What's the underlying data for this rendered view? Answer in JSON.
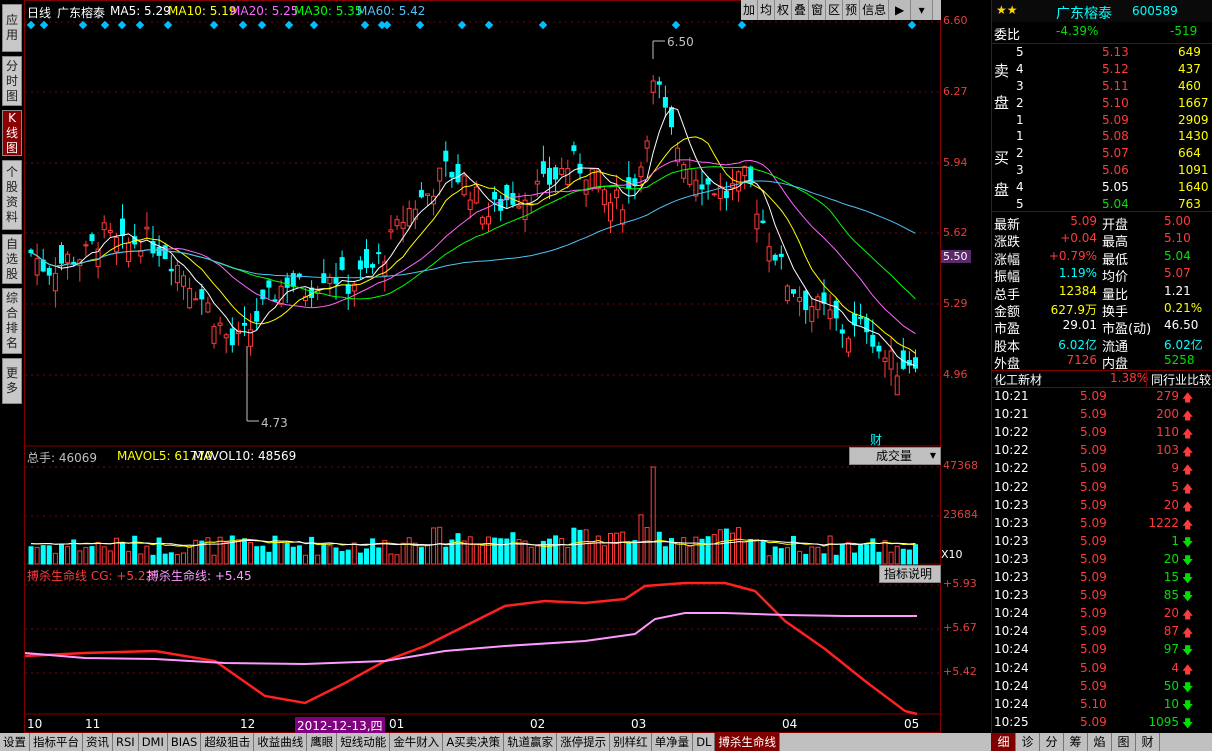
{
  "sidebar": {
    "tabs": [
      "应用",
      "分时图",
      "K线图",
      "个股资料",
      "自选股",
      "综合排名",
      "更多"
    ],
    "active": 2
  },
  "toolbar": {
    "items": [
      "加",
      "均",
      "权",
      "叠",
      "窗",
      "区",
      "预",
      "信息"
    ]
  },
  "kline": {
    "period_label": "日线",
    "stock_name": "广东榕泰",
    "ma5": "MA5: 5.29",
    "ma10": "MA10: 5.19",
    "ma20": "MA20: 5.25",
    "ma30": "MA30: 5.35",
    "ma60": "MA60: 5.42",
    "price_ticks": [
      "6.60",
      "6.27",
      "5.94",
      "5.62",
      "5.29",
      "4.96"
    ],
    "current_price_tag": "5.50",
    "high_label": "6.50",
    "low_label": "4.73",
    "cai_label": "财"
  },
  "volume": {
    "total_label": "总手: 46069",
    "mavol5": "MAVOL5: 61770",
    "mavol10": "MAVOL10: 48569",
    "selector": "成交量",
    "ticks": [
      "47368",
      "23684"
    ],
    "multiplier": "X10"
  },
  "indicator": {
    "name": "搏杀生命线 CG: +5.22",
    "name2": "搏杀生命线: +5.45",
    "help": "指标说明",
    "ticks": [
      "+5.93",
      "+5.67",
      "+5.42"
    ]
  },
  "xaxis": {
    "labels": [
      "10",
      "11",
      "12",
      "01",
      "02",
      "03",
      "04",
      "05"
    ],
    "cursor_date": "2012-12-13,四"
  },
  "quote": {
    "name": "广东榕泰",
    "code": "600589",
    "weibi_label": "委比",
    "weibi": "-4.39%",
    "weicha": "-519",
    "sell_label": [
      "卖",
      "盘"
    ],
    "buy_label": [
      "买",
      "盘"
    ],
    "sell": [
      {
        "n": "5",
        "p": "5.13",
        "v": "649"
      },
      {
        "n": "4",
        "p": "5.12",
        "v": "437"
      },
      {
        "n": "3",
        "p": "5.11",
        "v": "460"
      },
      {
        "n": "2",
        "p": "5.10",
        "v": "1667"
      },
      {
        "n": "1",
        "p": "5.09",
        "v": "2909"
      }
    ],
    "buy": [
      {
        "n": "1",
        "p": "5.08",
        "v": "1430"
      },
      {
        "n": "2",
        "p": "5.07",
        "v": "664"
      },
      {
        "n": "3",
        "p": "5.06",
        "v": "1091"
      },
      {
        "n": "4",
        "p": "5.05",
        "v": "1640"
      },
      {
        "n": "5",
        "p": "5.04",
        "v": "763"
      }
    ],
    "stats": [
      {
        "l": "最新",
        "v": "5.09",
        "l2": "开盘",
        "v2": "5.00"
      },
      {
        "l": "涨跌",
        "v": "+0.04",
        "l2": "最高",
        "v2": "5.10"
      },
      {
        "l": "涨幅",
        "v": "+0.79%",
        "l2": "最低",
        "v2": "5.04"
      },
      {
        "l": "振幅",
        "v": "1.19%",
        "l2": "均价",
        "v2": "5.07"
      },
      {
        "l": "总手",
        "v": "12384",
        "l2": "量比",
        "v2": "1.21"
      },
      {
        "l": "金额",
        "v": "627.9万",
        "l2": "换手",
        "v2": "0.21%"
      },
      {
        "l": "市盈",
        "v": "29.01",
        "l2": "市盈(动)",
        "v2": "46.50"
      },
      {
        "l": "股本",
        "v": "6.02亿",
        "l2": "流通",
        "v2": "6.02亿"
      },
      {
        "l": "外盘",
        "v": "7126",
        "l2": "内盘",
        "v2": "5258"
      }
    ],
    "industry": "化工新材",
    "industry_pct": "1.38%",
    "industry_btn": "同行业比较",
    "ticks": [
      {
        "t": "10:21",
        "p": "5.09",
        "v": "279",
        "d": "up"
      },
      {
        "t": "10:21",
        "p": "5.09",
        "v": "200",
        "d": "up"
      },
      {
        "t": "10:22",
        "p": "5.09",
        "v": "110",
        "d": "up"
      },
      {
        "t": "10:22",
        "p": "5.09",
        "v": "103",
        "d": "up"
      },
      {
        "t": "10:22",
        "p": "5.09",
        "v": "9",
        "d": "up"
      },
      {
        "t": "10:22",
        "p": "5.09",
        "v": "5",
        "d": "up"
      },
      {
        "t": "10:23",
        "p": "5.09",
        "v": "20",
        "d": "up"
      },
      {
        "t": "10:23",
        "p": "5.09",
        "v": "1222",
        "d": "up"
      },
      {
        "t": "10:23",
        "p": "5.09",
        "v": "1",
        "d": "down"
      },
      {
        "t": "10:23",
        "p": "5.09",
        "v": "20",
        "d": "down"
      },
      {
        "t": "10:23",
        "p": "5.09",
        "v": "15",
        "d": "down"
      },
      {
        "t": "10:23",
        "p": "5.09",
        "v": "85",
        "d": "down"
      },
      {
        "t": "10:24",
        "p": "5.09",
        "v": "20",
        "d": "up"
      },
      {
        "t": "10:24",
        "p": "5.09",
        "v": "87",
        "d": "up"
      },
      {
        "t": "10:24",
        "p": "5.09",
        "v": "97",
        "d": "down"
      },
      {
        "t": "10:24",
        "p": "5.09",
        "v": "4",
        "d": "up"
      },
      {
        "t": "10:24",
        "p": "5.09",
        "v": "50",
        "d": "down"
      },
      {
        "t": "10:24",
        "p": "5.10",
        "v": "10",
        "d": "down"
      },
      {
        "t": "10:25",
        "p": "5.09",
        "v": "1095",
        "d": "down"
      }
    ],
    "bottom_tabs": [
      "细",
      "诊",
      "分",
      "筹",
      "焰",
      "图",
      "财"
    ]
  },
  "bottom_tabs": [
    "设置",
    "指标平台",
    "资讯",
    "RSI",
    "DMI",
    "BIAS",
    "超级狙击",
    "收益曲线",
    "鹰眼",
    "短线动能",
    "金牛财入",
    "A买卖决策",
    "轨道赢家",
    "涨停提示",
    "别样红",
    "单净量",
    "DL",
    "搏杀生命线"
  ],
  "bottom_active": 17
}
